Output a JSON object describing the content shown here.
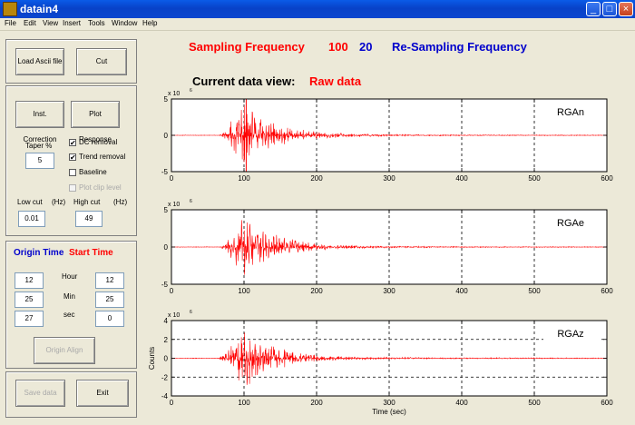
{
  "window": {
    "title": "datain4",
    "min_glyph": "_",
    "max_glyph": "□",
    "close_glyph": "×"
  },
  "menu": [
    "File",
    "Edit",
    "View",
    "Insert",
    "Tools",
    "Window",
    "Help"
  ],
  "header": {
    "sampling_label": "Sampling Frequency",
    "sampling_value": "100",
    "resampling_value": "20",
    "resampling_label": "Re-Sampling Frequency",
    "current_view_label": "Current data view:",
    "current_view_value": "Raw data"
  },
  "left": {
    "load_button": "Load Ascii file",
    "cut_button": "Cut",
    "inst_correction_button": "Inst. Correction",
    "plot_response_button": "Plot Response",
    "taper_label": "Taper %",
    "taper_value": "5",
    "dc_removal": {
      "label": "DC removal",
      "checked": true
    },
    "trend_removal": {
      "label": "Trend removal",
      "checked": true
    },
    "baseline": {
      "label": "Baseline",
      "checked": false
    },
    "plot_clip": {
      "label": "Plot clip level",
      "checked": false
    },
    "check_mark": "✔",
    "low_cut_label": "Low cut",
    "low_cut_unit": "(Hz)",
    "low_cut_value": "0.01",
    "high_cut_label": "High cut",
    "high_cut_unit": "(Hz)",
    "high_cut_value": "49",
    "origin_time_label": "Origin Time",
    "start_time_label": "Start Time",
    "hour_label": "Hour",
    "min_label": "Min",
    "sec_label": "sec",
    "origin_hour": "12",
    "origin_min": "25",
    "origin_sec": "27",
    "start_hour": "12",
    "start_min": "25",
    "start_sec": "0",
    "origin_align_button": "Origin Align",
    "save_button": "Save data",
    "exit_button": "Exit"
  },
  "colors": {
    "accent_red": "#ff0000",
    "accent_blue": "#0000cc",
    "trace": "#ff0000"
  },
  "chart_data": [
    {
      "type": "line",
      "title": "",
      "station": "RGAn",
      "exponent_label": "x 10",
      "exponent": "6",
      "xlabel": "",
      "ylabel": "",
      "xlim": [
        0,
        600
      ],
      "ylim": [
        -5,
        5
      ],
      "x_ticks": [
        0,
        100,
        200,
        300,
        400,
        500,
        600
      ],
      "y_ticks": [
        -5,
        0,
        5
      ],
      "grid": {
        "vertical": [
          100,
          200,
          300,
          400,
          500
        ],
        "horizontal": []
      },
      "onset": 65,
      "peak_time": 96,
      "peak_amp": 4.6,
      "decay": 45,
      "noise": 0.03,
      "seed": 11,
      "marker_x": 103
    },
    {
      "type": "line",
      "title": "",
      "station": "RGAe",
      "exponent_label": "x 10",
      "exponent": "6",
      "xlabel": "",
      "ylabel": "",
      "xlim": [
        0,
        600
      ],
      "ylim": [
        -5,
        5
      ],
      "x_ticks": [
        0,
        100,
        200,
        300,
        400,
        500,
        600
      ],
      "y_ticks": [
        -5,
        0,
        5
      ],
      "grid": {
        "vertical": [
          100,
          200,
          300,
          400,
          500
        ],
        "horizontal": []
      },
      "onset": 65,
      "peak_time": 100,
      "peak_amp": 4.4,
      "decay": 45,
      "noise": 0.03,
      "seed": 23,
      "marker_x": null
    },
    {
      "type": "line",
      "title": "",
      "station": "RGAz",
      "exponent_label": "x 10",
      "exponent": "6",
      "xlabel": "Time (sec)",
      "ylabel": "Counts",
      "xlim": [
        0,
        600
      ],
      "ylim": [
        -4,
        4
      ],
      "x_ticks": [
        0,
        100,
        200,
        300,
        400,
        500,
        600
      ],
      "y_ticks": [
        -4,
        -2,
        0,
        2,
        4
      ],
      "grid": {
        "vertical": [
          100,
          200,
          300,
          400,
          500
        ],
        "horizontal": [
          -2,
          2
        ]
      },
      "onset": 63,
      "peak_time": 100,
      "peak_amp": 3.4,
      "decay": 40,
      "noise": 0.03,
      "seed": 37,
      "marker_x": null
    }
  ]
}
